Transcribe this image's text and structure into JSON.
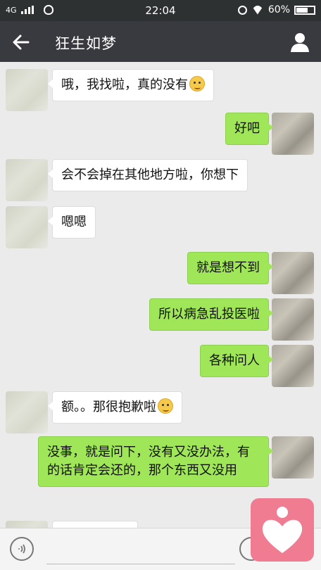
{
  "status_bar": {
    "network": "4G",
    "time": "22:04",
    "battery": "60%"
  },
  "nav": {
    "title": "狂生如梦"
  },
  "messages": [
    {
      "side": "left",
      "text": "哦，我找啦，真的没有"
    },
    {
      "side": "right",
      "text": "好吧"
    },
    {
      "side": "left",
      "text": "会不会掉在其他地方啦，你想下"
    },
    {
      "side": "left",
      "text": "嗯嗯"
    },
    {
      "side": "right",
      "text": "就是想不到"
    },
    {
      "side": "right",
      "text": "所以病急乱投医啦"
    },
    {
      "side": "right",
      "text": "各种问人"
    },
    {
      "side": "left",
      "text": "额。。那很抱歉啦"
    },
    {
      "side": "right",
      "text": "没事，就是问下，没有又没办法，有的话肯定会还的，那个东西又没用"
    }
  ],
  "colors": {
    "status_bar": "#2e3132",
    "nav_bar": "#393a3f",
    "chat_background": "#ebebeb",
    "bubble_sent": "#9fe658",
    "bubble_received": "#ffffff",
    "heart_button": "#f07c92"
  },
  "icons": {
    "back": "arrow-left-icon",
    "profile": "person-icon",
    "voice": "voice-icon",
    "emoji": "emoji-icon",
    "heart": "heart-icon"
  }
}
